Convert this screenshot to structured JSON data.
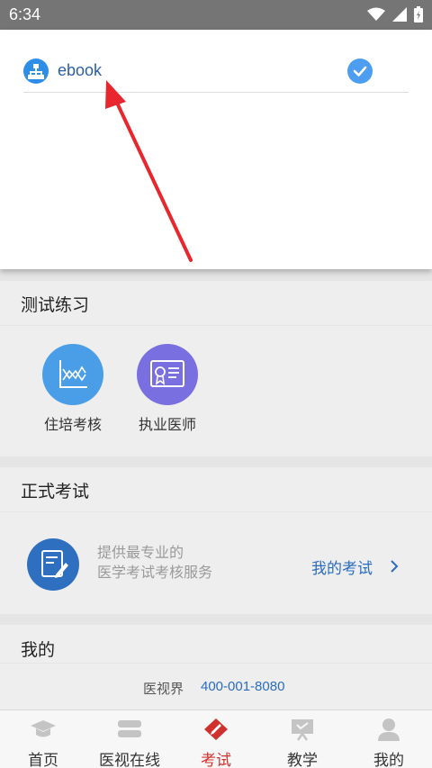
{
  "status_bar": {
    "time": "6:34"
  },
  "dropdown": {
    "account_label": "ebook"
  },
  "practice": {
    "title": "测试练习",
    "items": [
      {
        "label": "住培考核",
        "color": "#4a9ee8"
      },
      {
        "label": "执业医师",
        "color": "#7a6fe0"
      }
    ]
  },
  "formal_exam": {
    "title": "正式考试",
    "desc_line1": "提供最专业的",
    "desc_line2": "医学考试考核服务",
    "my_exam_link": "我的考试"
  },
  "mine": {
    "title": "我的",
    "company": "医视界",
    "phone": "400-001-8080"
  },
  "nav": {
    "items": [
      {
        "label": "首页"
      },
      {
        "label": "医视在线"
      },
      {
        "label": "考试"
      },
      {
        "label": "教学"
      },
      {
        "label": "我的"
      }
    ]
  },
  "colors": {
    "accent": "#2b6cbf",
    "active_tab": "#d0312d",
    "status_bar": "#757575"
  }
}
